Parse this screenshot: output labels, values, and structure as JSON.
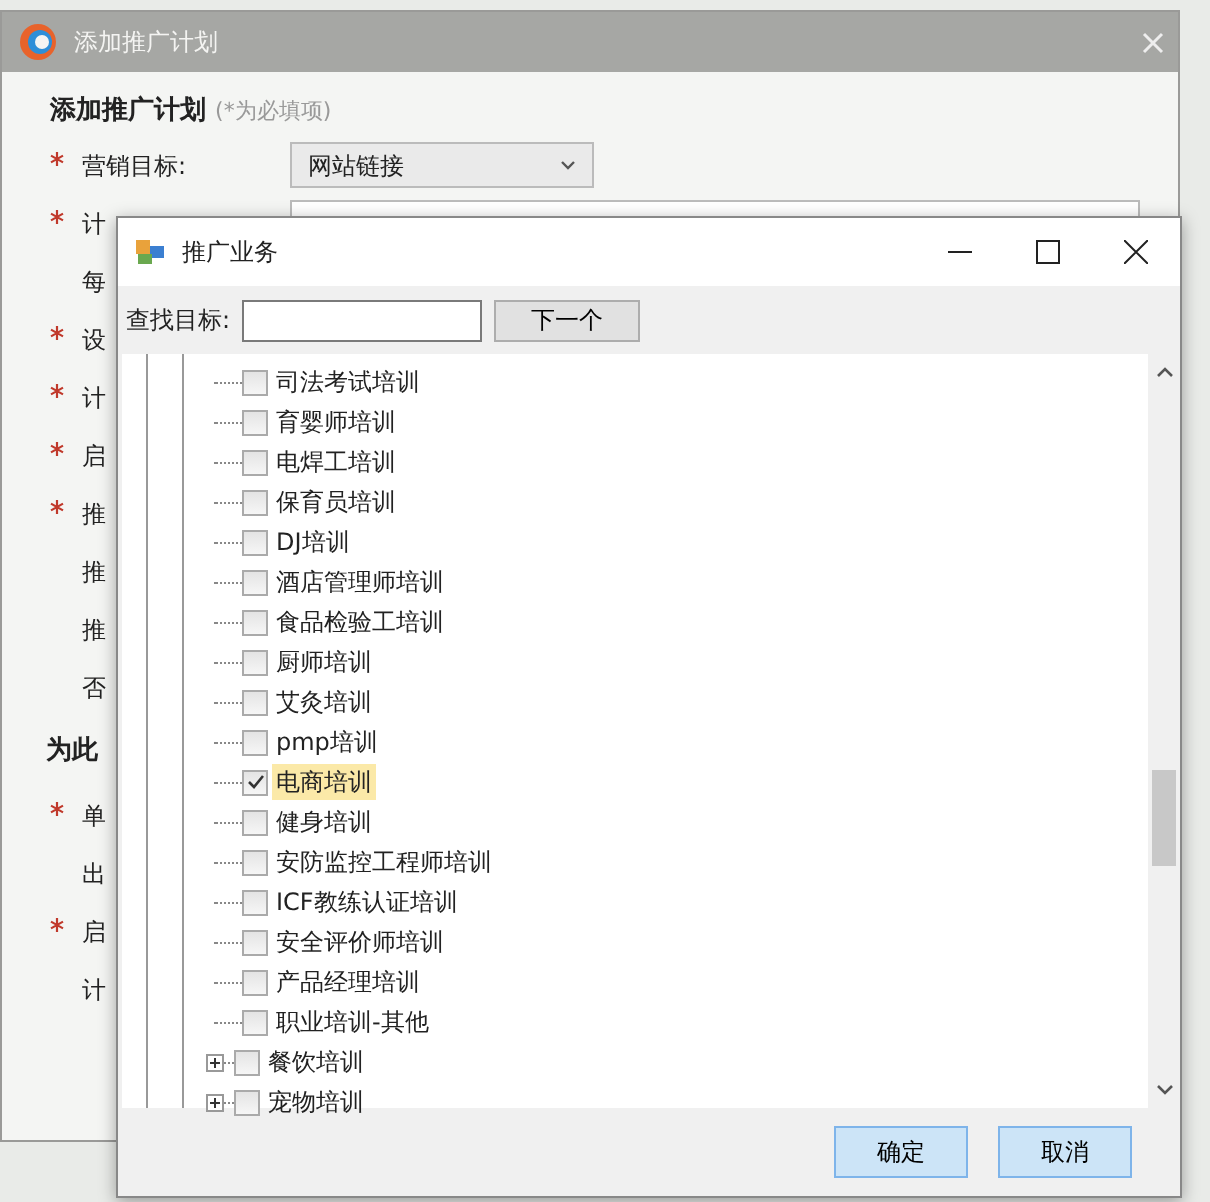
{
  "back_dialog": {
    "title": "添加推广计划",
    "heading": "添加推广计划",
    "heading_note": "(*为必填项)",
    "rows": [
      {
        "kind": "select",
        "label": "营销目标:",
        "required": true,
        "value": "网站链接"
      },
      {
        "kind": "field",
        "label": "计",
        "required": true
      },
      {
        "kind": "label",
        "label": "每",
        "required": false
      },
      {
        "kind": "label",
        "label": "设",
        "required": true
      },
      {
        "kind": "label",
        "label": "计",
        "required": true
      },
      {
        "kind": "label",
        "label": "启",
        "required": true
      },
      {
        "kind": "label",
        "label": "推",
        "required": true
      },
      {
        "kind": "label",
        "label": "推",
        "required": false
      },
      {
        "kind": "label",
        "label": "推",
        "required": false
      },
      {
        "kind": "label",
        "label": "否",
        "required": false
      },
      {
        "kind": "section",
        "label": "为此"
      },
      {
        "kind": "label",
        "label": "单",
        "required": true
      },
      {
        "kind": "label",
        "label": "出",
        "required": false
      },
      {
        "kind": "label",
        "label": "启",
        "required": true
      },
      {
        "kind": "label",
        "label": "计",
        "required": false
      }
    ]
  },
  "picker": {
    "title": "推广业务",
    "search_label": "查找目标:",
    "search_button": "下一个",
    "items": [
      {
        "label": "司法考试培训",
        "checked": false,
        "selected": false,
        "expandable": false
      },
      {
        "label": "育婴师培训",
        "checked": false,
        "selected": false,
        "expandable": false
      },
      {
        "label": "电焊工培训",
        "checked": false,
        "selected": false,
        "expandable": false
      },
      {
        "label": "保育员培训",
        "checked": false,
        "selected": false,
        "expandable": false
      },
      {
        "label": "DJ培训",
        "checked": false,
        "selected": false,
        "expandable": false
      },
      {
        "label": "酒店管理师培训",
        "checked": false,
        "selected": false,
        "expandable": false
      },
      {
        "label": "食品检验工培训",
        "checked": false,
        "selected": false,
        "expandable": false
      },
      {
        "label": "厨师培训",
        "checked": false,
        "selected": false,
        "expandable": false
      },
      {
        "label": "艾灸培训",
        "checked": false,
        "selected": false,
        "expandable": false
      },
      {
        "label": "pmp培训",
        "checked": false,
        "selected": false,
        "expandable": false
      },
      {
        "label": "电商培训",
        "checked": true,
        "selected": true,
        "expandable": false
      },
      {
        "label": "健身培训",
        "checked": false,
        "selected": false,
        "expandable": false
      },
      {
        "label": "安防监控工程师培训",
        "checked": false,
        "selected": false,
        "expandable": false
      },
      {
        "label": "ICF教练认证培训",
        "checked": false,
        "selected": false,
        "expandable": false
      },
      {
        "label": "安全评价师培训",
        "checked": false,
        "selected": false,
        "expandable": false
      },
      {
        "label": "产品经理培训",
        "checked": false,
        "selected": false,
        "expandable": false
      },
      {
        "label": "职业培训-其他",
        "checked": false,
        "selected": false,
        "expandable": false
      },
      {
        "label": "餐饮培训",
        "checked": false,
        "selected": false,
        "expandable": true
      },
      {
        "label": "宠物培训",
        "checked": false,
        "selected": false,
        "expandable": true
      }
    ],
    "buttons": [
      "确定",
      "取消"
    ]
  }
}
